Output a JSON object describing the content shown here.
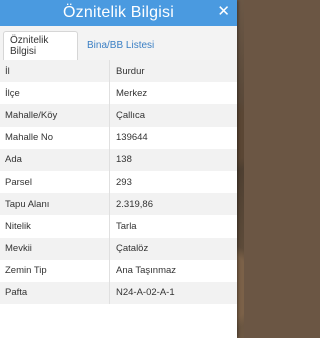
{
  "window": {
    "title": "Öznitelik Bilgisi",
    "close_glyph": "✕"
  },
  "tabs": [
    {
      "label": "Öznitelik Bilgisi",
      "active": true
    },
    {
      "label": "Bina/BB Listesi",
      "active": false
    }
  ],
  "attributes": [
    {
      "label": "İl",
      "value": "Burdur"
    },
    {
      "label": "İlçe",
      "value": "Merkez"
    },
    {
      "label": "Mahalle/Köy",
      "value": "Çallıca"
    },
    {
      "label": "Mahalle No",
      "value": "139644"
    },
    {
      "label": "Ada",
      "value": "138"
    },
    {
      "label": "Parsel",
      "value": "293"
    },
    {
      "label": "Tapu Alanı",
      "value": "2.319,86"
    },
    {
      "label": "Nitelik",
      "value": "Tarla"
    },
    {
      "label": "Mevkii",
      "value": "Çatalöz"
    },
    {
      "label": "Zemin Tip",
      "value": "Ana Taşınmaz"
    },
    {
      "label": "Pafta",
      "value": "N24-A-02-A-1"
    }
  ],
  "colors": {
    "titlebar": "#4a9ae0",
    "tab_link": "#3a7fc4"
  }
}
